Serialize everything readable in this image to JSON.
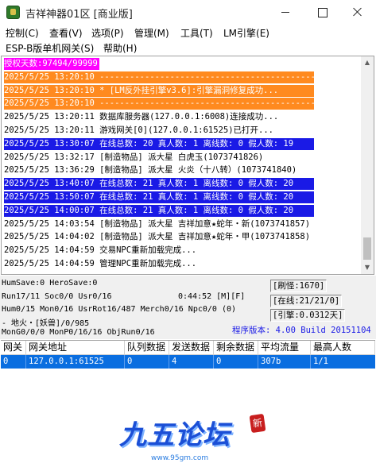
{
  "window": {
    "title": "吉祥神器01区 [商业版]"
  },
  "menu": {
    "row1": [
      "控制(C)",
      "查看(V)",
      "选项(P)",
      "管理(M)",
      "工具(T)",
      "LM引擎(E)"
    ],
    "row2": [
      "ESP-B版单机网关(S)",
      "帮助(H)"
    ]
  },
  "log": [
    {
      "text": "授权天数:97494/99999",
      "style": "hl-magenta"
    },
    {
      "text": "2025/5/25 13:20:10 ---------------------------------------------",
      "style": "hl-orange"
    },
    {
      "text": "2025/5/25 13:20:10 * [LM反外挂引擎v3.6]:引擎漏洞修复成功...",
      "style": "hl-orange"
    },
    {
      "text": "2025/5/25 13:20:10 ---------------------------------------------",
      "style": "hl-orange"
    },
    {
      "text": "2025/5/25 13:20:11 数据库服务器(127.0.0.1:6008)连接成功...",
      "style": ""
    },
    {
      "text": "2025/5/25 13:20:11 游戏网关[0](127.0.0.1:61525)已打开...",
      "style": ""
    },
    {
      "text": "2025/5/25 13:30:07 在线总数: 20 真人数: 1 离线数: 0 假人数: 19",
      "style": "hl-blue"
    },
    {
      "text": "2025/5/25 13:32:17 [制造物品] 派大星 白虎玉(1073741826)",
      "style": ""
    },
    {
      "text": "2025/5/25 13:36:29 [制造物品] 派大星 火炎（十八转）(1073741840)",
      "style": ""
    },
    {
      "text": "2025/5/25 13:40:07 在线总数: 21 真人数: 1 离线数: 0 假人数: 20",
      "style": "hl-blue"
    },
    {
      "text": "2025/5/25 13:50:07 在线总数: 21 真人数: 1 离线数: 0 假人数: 20",
      "style": "hl-blue"
    },
    {
      "text": "2025/5/25 14:00:07 在线总数: 21 真人数: 1 离线数: 0 假人数: 20",
      "style": "hl-blue"
    },
    {
      "text": "2025/5/25 14:03:54 [制造物品] 派大星 吉祥加意★蛇年・新(1073741857)",
      "style": ""
    },
    {
      "text": "2025/5/25 14:04:02 [制造物品] 派大星 吉祥加意★蛇年・甲(1073741858)",
      "style": ""
    },
    {
      "text": "2025/5/25 14:04:59 交易NPC重新加载完成...",
      "style": ""
    },
    {
      "text": "2025/5/25 14:04:59 管理NPC重新加载完成...",
      "style": ""
    }
  ],
  "status": {
    "line1": "HumSave:0 HeroSave:0",
    "line2": "Run17/11 Soc0/0 Usr0/16",
    "clock": "0:44:52 [M][F]",
    "line3": "Hum0/15 Mon0/16 UsrRot16/487 Merch0/16 Npc0/0 (0)",
    "line4": " - 地火・[妖兽]/0/985",
    "line5": "MonG0/0/0 MonP0/16/16 ObjRun0/16",
    "box_refresh": "[刷怪:1670]",
    "box_online": "[在线:21/21/0]",
    "box_engine": "[引擎:0.0312天]",
    "version": "程序版本: 4.00 Build 20151104"
  },
  "table": {
    "columns": [
      "网关",
      "网关地址",
      "队列数据",
      "发送数据",
      "剩余数据",
      "平均流量",
      "最高人数"
    ],
    "rows": [
      [
        "0",
        "127.0.0.1:61525",
        "0",
        "4",
        "0",
        "307b",
        "1/1"
      ]
    ]
  },
  "watermark": {
    "title": "九五论坛",
    "seal": "新",
    "url": "www.95gm.com"
  }
}
